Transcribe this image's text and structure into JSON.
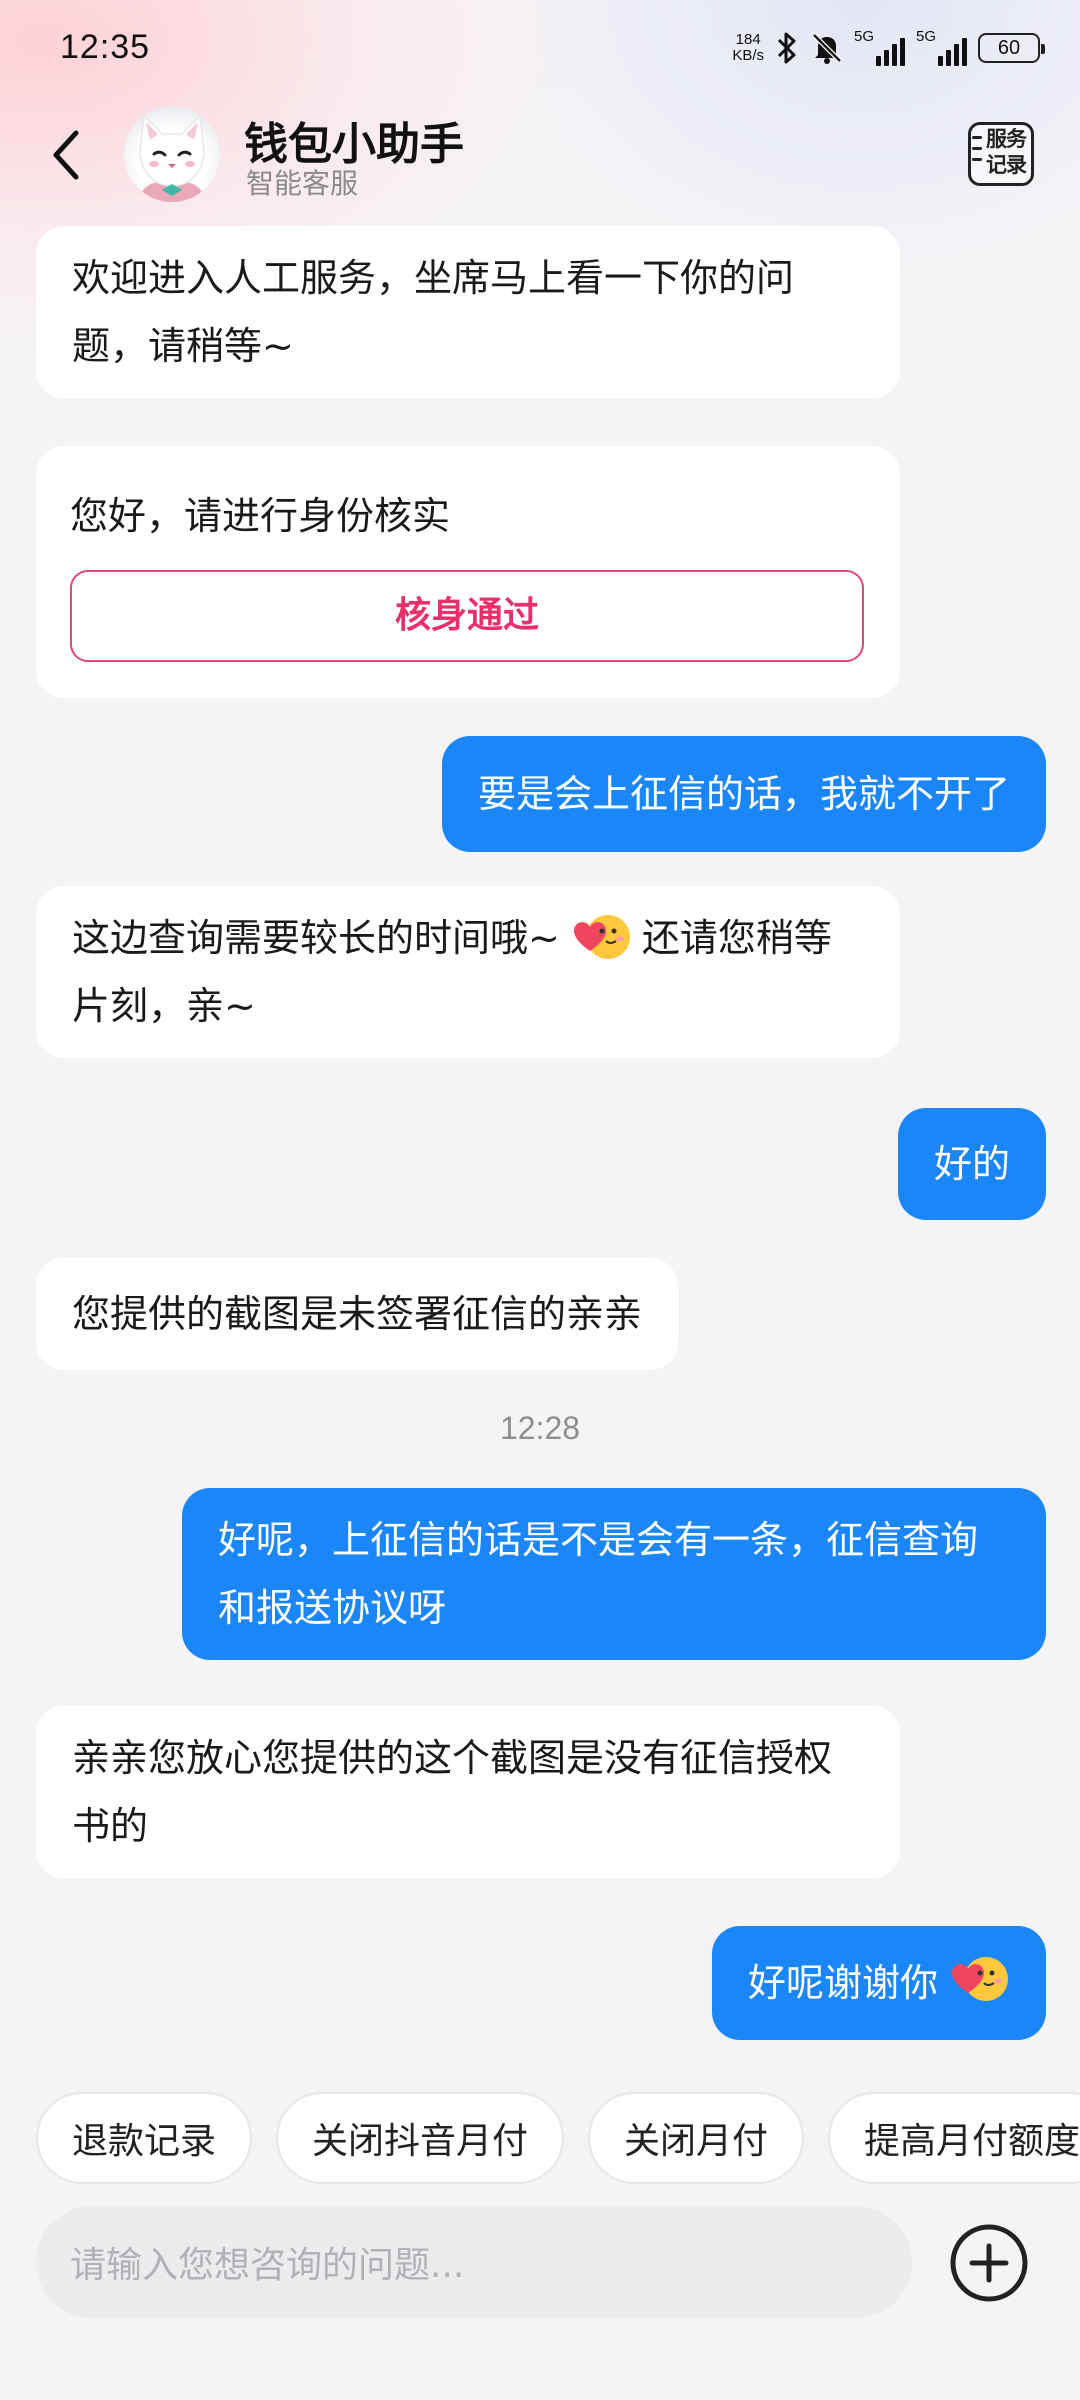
{
  "status_bar": {
    "time": "12:35",
    "net_speed_value": "184",
    "net_speed_unit": "KB/s",
    "sim1": "5G",
    "sim2": "5G",
    "battery": "60"
  },
  "header": {
    "title": "钱包小助手",
    "subtitle": "智能客服",
    "service_record_label": "服务记录"
  },
  "messages": [
    {
      "side": "left",
      "text": "欢迎进入人工服务，坐席马上看一下你的问题，请稍等~"
    },
    {
      "side": "left",
      "text": "您好，请进行身份核实",
      "button": "核身通过"
    },
    {
      "side": "right",
      "text": "要是会上征信的话，我就不开了"
    },
    {
      "side": "left",
      "text_before_emoji": "这边查询需要较长的时间哦~",
      "text_after_emoji": "还请您稍等片刻，亲~"
    },
    {
      "side": "right",
      "text": "好的"
    },
    {
      "side": "left",
      "text": "您提供的截图是未签署征信的亲亲"
    },
    {
      "side": "right",
      "text": "好呢，上征信的话是不是会有一条，征信查询和报送协议呀"
    },
    {
      "side": "left",
      "text": "亲亲您放心您提供的这个截图是没有征信授权书的"
    },
    {
      "side": "right",
      "text": "好呢谢谢你"
    }
  ],
  "timestamp": "12:28",
  "quick_replies": [
    "退款记录",
    "关闭抖音月付",
    "关闭月付",
    "提高月付额度"
  ],
  "input": {
    "placeholder": "请输入您想咨询的问题..."
  },
  "colors": {
    "accent_blue": "#1a86f7",
    "verify_pink": "#e8306a"
  }
}
